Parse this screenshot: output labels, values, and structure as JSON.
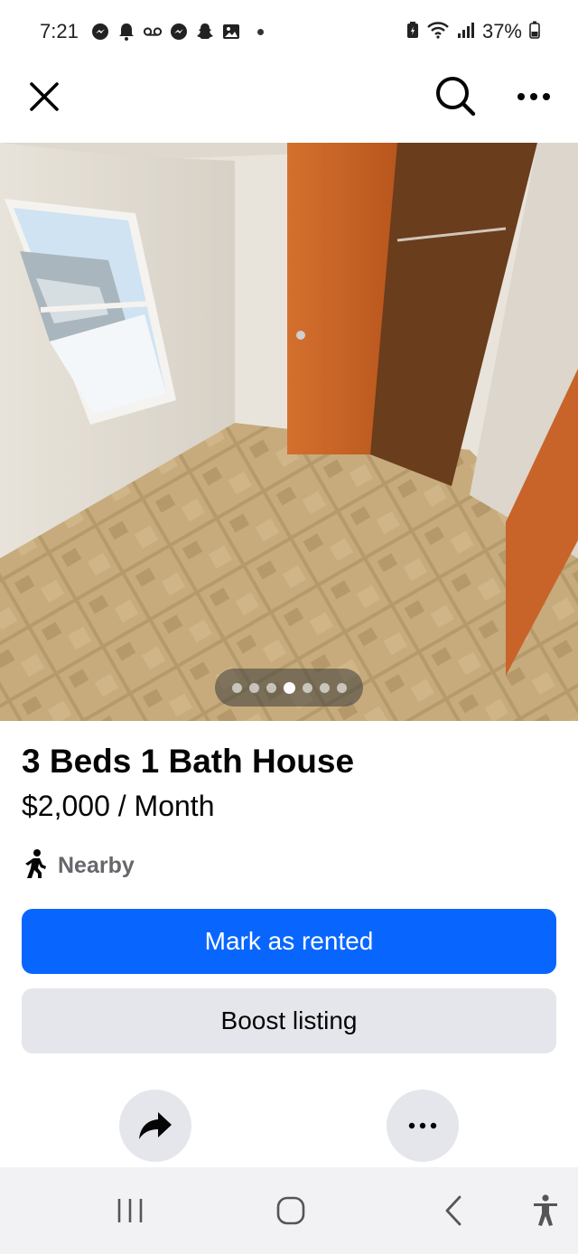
{
  "status_bar": {
    "time": "7:21",
    "battery_percent": "37%",
    "left_icons": [
      "messenger-icon",
      "notification-bell-icon",
      "voicemail-icon",
      "messenger-icon",
      "snapchat-icon",
      "gallery-icon"
    ],
    "right_icons": [
      "battery-saver-icon",
      "wifi-icon",
      "signal-icon",
      "battery-icon"
    ]
  },
  "top_nav": {
    "icons": [
      "close-icon",
      "search-icon",
      "more-icon"
    ]
  },
  "photo": {
    "carousel": {
      "total": 7,
      "active_index": 3
    }
  },
  "listing": {
    "title": "3 Beds 1 Bath House",
    "price": "$2,000 / Month",
    "location": "Nearby"
  },
  "actions": {
    "primary_label": "Mark as rented",
    "secondary_label": "Boost listing"
  },
  "colors": {
    "primary": "#0866ff",
    "secondary_bg": "#e4e6eb",
    "muted_text": "#65676b"
  },
  "system_nav": {
    "icons": [
      "recent-apps-icon",
      "home-icon",
      "back-icon",
      "accessibility-icon"
    ]
  }
}
